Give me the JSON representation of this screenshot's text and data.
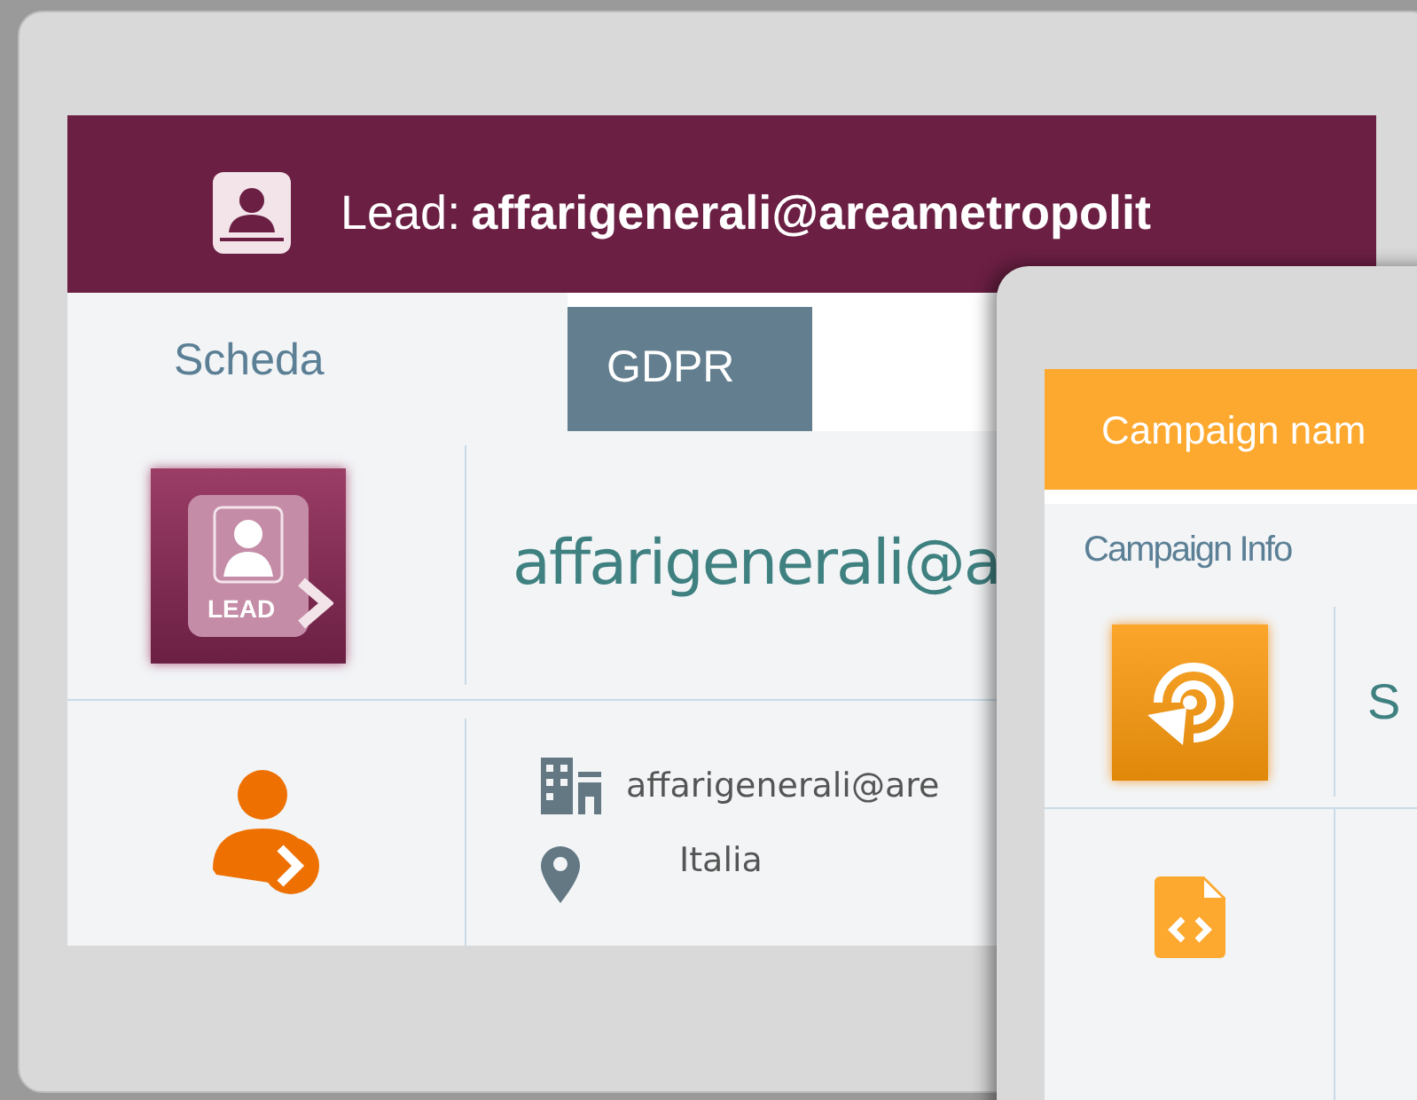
{
  "lead_window": {
    "title_label": "Lead:",
    "title_value": "affarigenerali@areametropolit",
    "tabs": [
      {
        "label": "Scheda",
        "selected": true
      },
      {
        "label": "GDPR",
        "selected": false
      }
    ],
    "name": "affarigenerali@a",
    "company": "affarigenerali@are",
    "country": "Italia",
    "badge": "LEAD"
  },
  "campaign_window": {
    "title": "Campaign nam",
    "tabs": [
      {
        "label": "Campaign Info",
        "selected": true
      }
    ],
    "name": "S"
  }
}
